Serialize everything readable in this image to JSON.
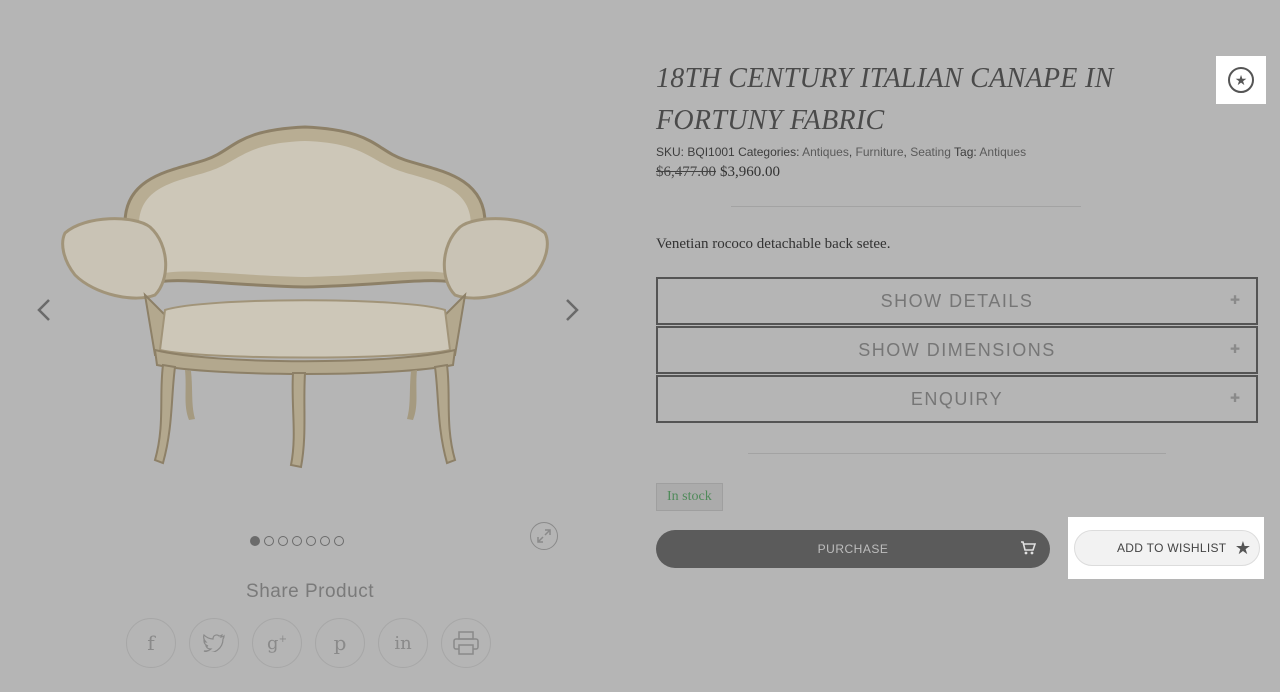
{
  "product": {
    "title": "18TH CENTURY ITALIAN CANAPE IN FORTUNY FABRIC",
    "sku_label": "SKU:",
    "sku": "BQI1001",
    "categories_label": "Categories:",
    "categories": [
      "Antiques",
      "Furniture",
      "Seating"
    ],
    "tag_label": "Tag:",
    "tag": "Antiques",
    "old_price": "$6,477.00",
    "price": "$3,960.00",
    "description": "Venetian rococo detachable back setee.",
    "stock": "In stock"
  },
  "accordions": [
    {
      "label": "SHOW DETAILS"
    },
    {
      "label": "SHOW DIMENSIONS"
    },
    {
      "label": "ENQUIRY"
    }
  ],
  "actions": {
    "purchase_label": "PURCHASE",
    "wishlist_label": "ADD TO WISHLIST"
  },
  "gallery": {
    "slide_count": 7,
    "active_slide": 1
  },
  "share": {
    "title": "Share Product",
    "icons": [
      "facebook-icon",
      "twitter-icon",
      "google-plus-icon",
      "pinterest-icon",
      "linkedin-icon",
      "print-icon"
    ]
  },
  "colors": {
    "overlay": "#b5b5b5",
    "stock_green": "#4f8a5a",
    "purchase_bg": "#5b5b5b"
  }
}
